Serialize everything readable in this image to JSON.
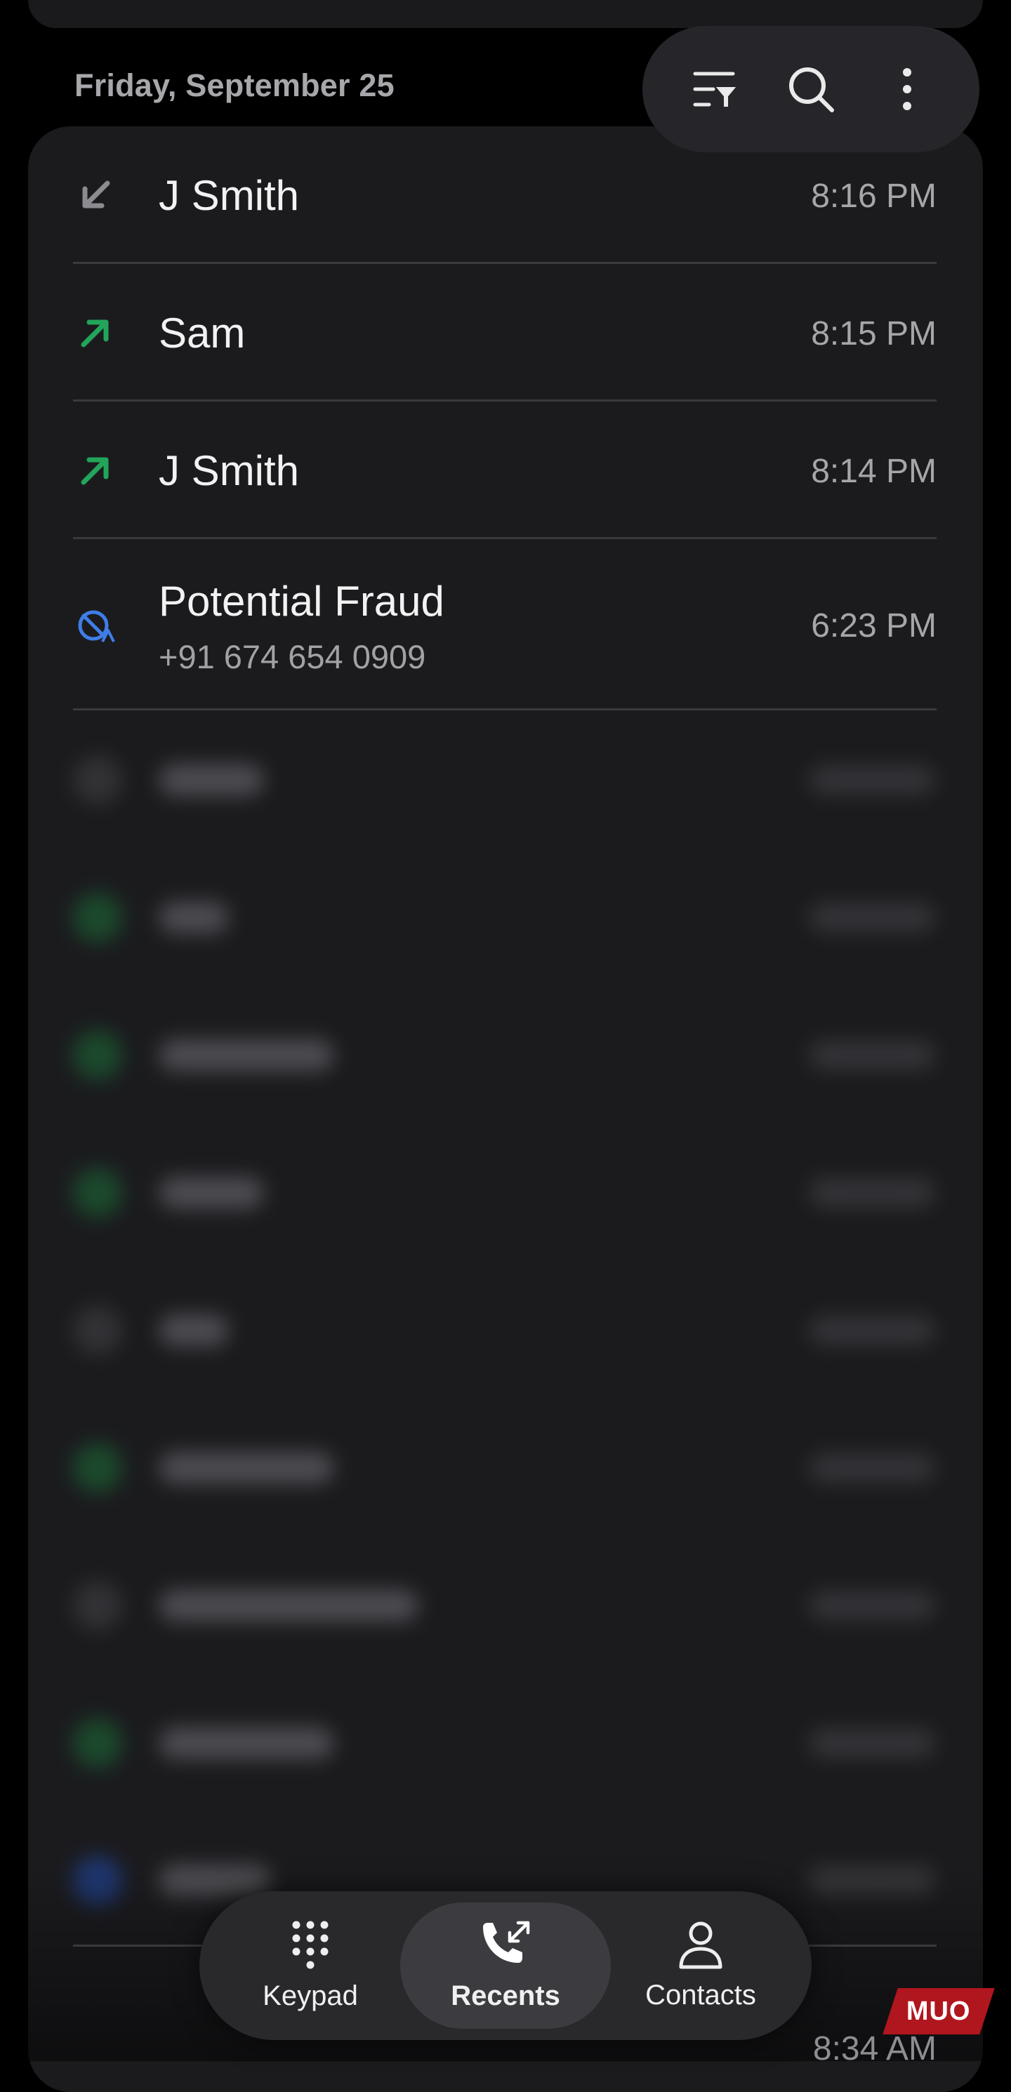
{
  "date_header": "Friday, September 25",
  "toolbar": {
    "icons": [
      "filter-icon",
      "search-icon",
      "more-vert-icon"
    ]
  },
  "calls": [
    {
      "name": "J Smith",
      "time": "8:16 PM",
      "direction": "incoming",
      "icon": "incoming-call-icon",
      "color": "#8c8c90"
    },
    {
      "name": "Sam",
      "time": "8:15 PM",
      "direction": "outgoing",
      "icon": "outgoing-call-icon",
      "color": "#22a55a"
    },
    {
      "name": "J Smith",
      "time": "8:14 PM",
      "direction": "outgoing",
      "icon": "outgoing-call-icon",
      "color": "#22a55a"
    },
    {
      "name": "Potential Fraud",
      "number": "+91 674 654 0909",
      "time": "6:23 PM",
      "direction": "blocked",
      "icon": "blocked-call-icon",
      "color": "#3f7de8"
    }
  ],
  "partial_call": {
    "time": "8:34 AM"
  },
  "nav": {
    "items": [
      {
        "label": "Keypad",
        "icon": "keypad-icon"
      },
      {
        "label": "Recents",
        "icon": "recents-icon",
        "active": true
      },
      {
        "label": "Contacts",
        "icon": "contacts-icon"
      }
    ]
  },
  "watermark": "MUO"
}
